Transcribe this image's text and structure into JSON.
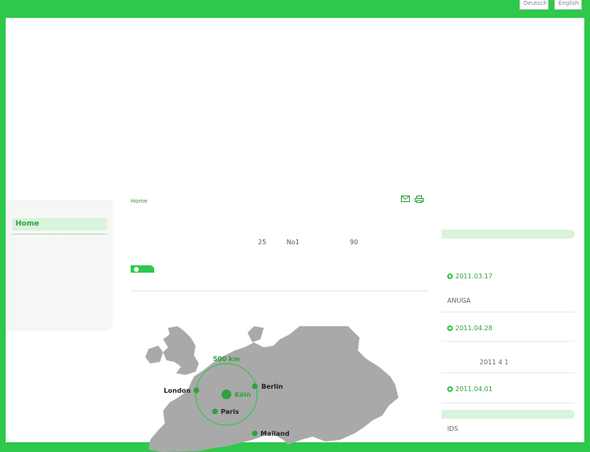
{
  "language_switcher": {
    "deutsch": "Deutsch",
    "english": "English"
  },
  "sidebar": {
    "items": [
      {
        "label": "Home"
      }
    ]
  },
  "breadcrumb": {
    "home": "Home"
  },
  "toolbar": {
    "mail_icon": "mail-icon",
    "print_icon": "print-icon"
  },
  "intro": {
    "value_1": "25",
    "value_2": "No1",
    "value_3": "90"
  },
  "map": {
    "scale_label": "500 km",
    "cities": [
      "London",
      "Köln",
      "Berlin",
      "Paris",
      "Mailand"
    ]
  },
  "news": [
    {
      "date": "2011.03.17",
      "text": "ANUGA"
    },
    {
      "date": "2011.04.28",
      "text": "2011 4 1"
    },
    {
      "date": "2011.04.01",
      "text": ""
    },
    {
      "date": "",
      "text": "IDS"
    }
  ],
  "colors": {
    "brand_green": "#2ec84a",
    "light_green": "#d9f3dc",
    "map_gray": "#a9a9a9"
  }
}
